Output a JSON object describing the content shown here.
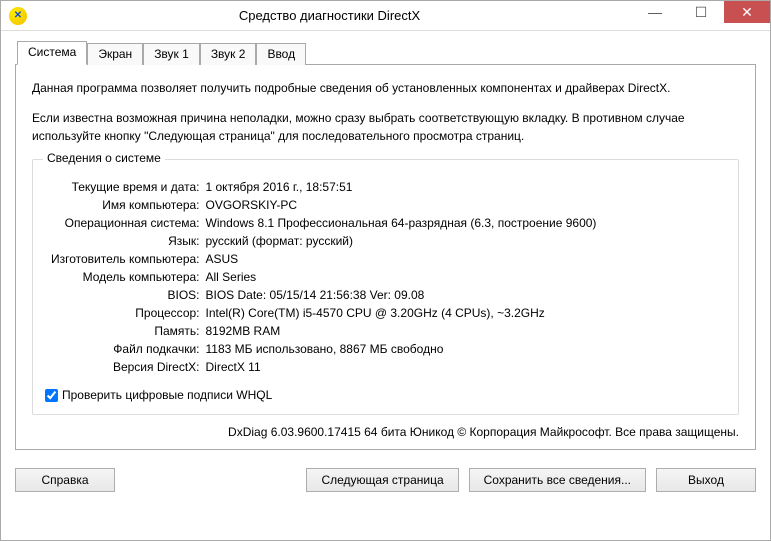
{
  "window": {
    "title": "Средство диагностики DirectX"
  },
  "tabs": [
    "Система",
    "Экран",
    "Звук 1",
    "Звук 2",
    "Ввод"
  ],
  "intro_p1": "Данная программа позволяет получить подробные сведения об установленных компонентах и драйверах DirectX.",
  "intro_p2": "Если известна возможная причина неполадки, можно сразу выбрать соответствующую вкладку. В противном случае используйте кнопку \"Следующая страница\" для последовательного просмотра страниц.",
  "fieldset_title": "Сведения о системе",
  "rows": [
    {
      "label": "Текущие время и дата:",
      "value": "1 октября 2016 г., 18:57:51"
    },
    {
      "label": "Имя компьютера:",
      "value": "OVGORSKIY-PC"
    },
    {
      "label": "Операционная система:",
      "value": "Windows 8.1 Профессиональная 64-разрядная (6.3, построение 9600)"
    },
    {
      "label": "Язык:",
      "value": "русский (формат: русский)"
    },
    {
      "label": "Изготовитель компьютера:",
      "value": "ASUS"
    },
    {
      "label": "Модель компьютера:",
      "value": "All Series"
    },
    {
      "label": "BIOS:",
      "value": "BIOS Date: 05/15/14 21:56:38 Ver: 09.08"
    },
    {
      "label": "Процессор:",
      "value": "Intel(R) Core(TM) i5-4570 CPU @ 3.20GHz (4 CPUs), ~3.2GHz"
    },
    {
      "label": "Память:",
      "value": "8192MB RAM"
    },
    {
      "label": "Файл подкачки:",
      "value": "1183 МБ использовано, 8867 МБ свободно"
    },
    {
      "label": "Версия DirectX:",
      "value": "DirectX 11"
    }
  ],
  "checkbox_label": "Проверить цифровые подписи WHQL",
  "footer": "DxDiag 6.03.9600.17415 64 бита Юникод © Корпорация Майкрософт. Все права защищены.",
  "buttons": {
    "help": "Справка",
    "next": "Следующая страница",
    "save": "Сохранить все сведения...",
    "exit": "Выход"
  }
}
